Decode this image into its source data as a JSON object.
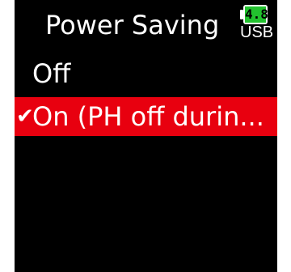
{
  "header": {
    "title": "Power Saving"
  },
  "battery": {
    "level": "4.8",
    "source": "USB",
    "level_color": "#22c22e"
  },
  "menu": {
    "items": [
      {
        "label": "Off",
        "selected": false,
        "icon": "checkmark-icon"
      },
      {
        "label": "On (PH off durin...",
        "selected": true,
        "icon": "checkmark-icon"
      }
    ],
    "selected_bg_color": "#e8000f",
    "check_glyph": "✔"
  }
}
